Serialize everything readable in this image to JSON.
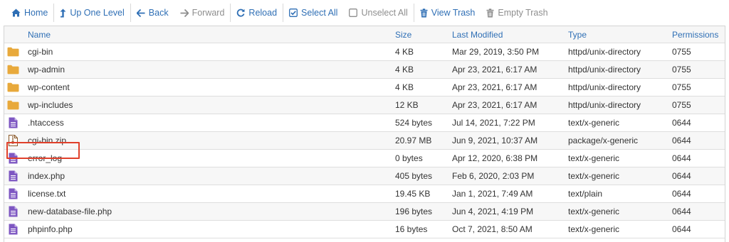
{
  "toolbar": {
    "buttons": [
      {
        "label": "Home",
        "icon": "home-icon",
        "enabled": true
      },
      {
        "label": "Up One Level",
        "icon": "level-up-icon",
        "enabled": true
      },
      {
        "label": "Back",
        "icon": "arrow-left-icon",
        "enabled": true
      },
      {
        "label": "Forward",
        "icon": "arrow-right-icon",
        "enabled": false
      },
      {
        "label": "Reload",
        "icon": "refresh-icon",
        "enabled": true
      },
      {
        "label": "Select All",
        "icon": "checked-box-icon",
        "enabled": true
      },
      {
        "label": "Unselect All",
        "icon": "unchecked-box-icon",
        "enabled": false
      },
      {
        "label": "View Trash",
        "icon": "trash-icon",
        "enabled": true
      },
      {
        "label": "Empty Trash",
        "icon": "trash-icon",
        "enabled": false
      }
    ]
  },
  "table": {
    "headers": {
      "name": "Name",
      "size": "Size",
      "modified": "Last Modified",
      "type": "Type",
      "permissions": "Permissions"
    },
    "rows": [
      {
        "icon": "folder-icon",
        "name": "cgi-bin",
        "size": "4 KB",
        "modified": "Mar 29, 2019, 3:50 PM",
        "type": "httpd/unix-directory",
        "permissions": "0755"
      },
      {
        "icon": "folder-icon",
        "name": "wp-admin",
        "size": "4 KB",
        "modified": "Apr 23, 2021, 6:17 AM",
        "type": "httpd/unix-directory",
        "permissions": "0755"
      },
      {
        "icon": "folder-icon",
        "name": "wp-content",
        "size": "4 KB",
        "modified": "Apr 23, 2021, 6:17 AM",
        "type": "httpd/unix-directory",
        "permissions": "0755"
      },
      {
        "icon": "folder-icon",
        "name": "wp-includes",
        "size": "12 KB",
        "modified": "Apr 23, 2021, 6:17 AM",
        "type": "httpd/unix-directory",
        "permissions": "0755"
      },
      {
        "icon": "text-file-icon",
        "name": ".htaccess",
        "size": "524 bytes",
        "modified": "Jul 14, 2021, 7:22 PM",
        "type": "text/x-generic",
        "permissions": "0644",
        "highlighted": true
      },
      {
        "icon": "zip-file-icon",
        "name": "cgi-bin.zip",
        "size": "20.97 MB",
        "modified": "Jun 9, 2021, 10:37 AM",
        "type": "package/x-generic",
        "permissions": "0644"
      },
      {
        "icon": "text-file-icon",
        "name": "error_log",
        "size": "0 bytes",
        "modified": "Apr 12, 2020, 6:38 PM",
        "type": "text/x-generic",
        "permissions": "0644"
      },
      {
        "icon": "text-file-icon",
        "name": "index.php",
        "size": "405 bytes",
        "modified": "Feb 6, 2020, 2:03 PM",
        "type": "text/x-generic",
        "permissions": "0644"
      },
      {
        "icon": "text-file-icon",
        "name": "license.txt",
        "size": "19.45 KB",
        "modified": "Jan 1, 2021, 7:49 AM",
        "type": "text/plain",
        "permissions": "0644"
      },
      {
        "icon": "text-file-icon",
        "name": "new-database-file.php",
        "size": "196 bytes",
        "modified": "Jun 4, 2021, 4:19 PM",
        "type": "text/x-generic",
        "permissions": "0644"
      },
      {
        "icon": "text-file-icon",
        "name": "phpinfo.php",
        "size": "16 bytes",
        "modified": "Oct 7, 2021, 8:50 AM",
        "type": "text/x-generic",
        "permissions": "0644"
      }
    ]
  },
  "colors": {
    "link": "#2f6fb5",
    "disabled": "#8e8e8e",
    "folder": "#e8a93b",
    "text_file": "#7e57c2",
    "zip_file": "#8a5a2b",
    "highlight_border": "#e0402b"
  }
}
